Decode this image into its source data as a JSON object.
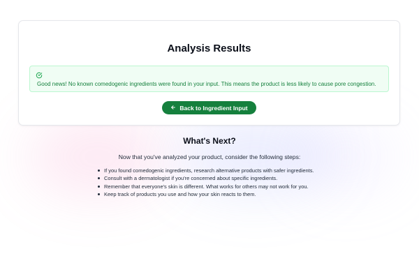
{
  "results": {
    "title": "Analysis Results",
    "alert_message": "Good news! No known comedogenic ingredients were found in your input. This means the product is less likely to cause pore congestion.",
    "alert_icon": "circle-check-icon",
    "back_button_label": "Back to Ingredient Input",
    "back_icon": "arrow-left-icon"
  },
  "next_steps": {
    "title": "What's Next?",
    "intro": "Now that you've analyzed your product, consider the following steps:",
    "items": [
      "If you found comedogenic ingredients, research alternative products with safer ingredients.",
      "Consult with a dermatologist if you're concerned about specific ingredients.",
      "Remember that everyone's skin is different. What works for others may not work for you.",
      "Keep track of products you use and how your skin reacts to them."
    ]
  },
  "colors": {
    "accent_green": "#15803d",
    "alert_background": "#f0fdf4",
    "alert_border": "#bbf7d0"
  }
}
